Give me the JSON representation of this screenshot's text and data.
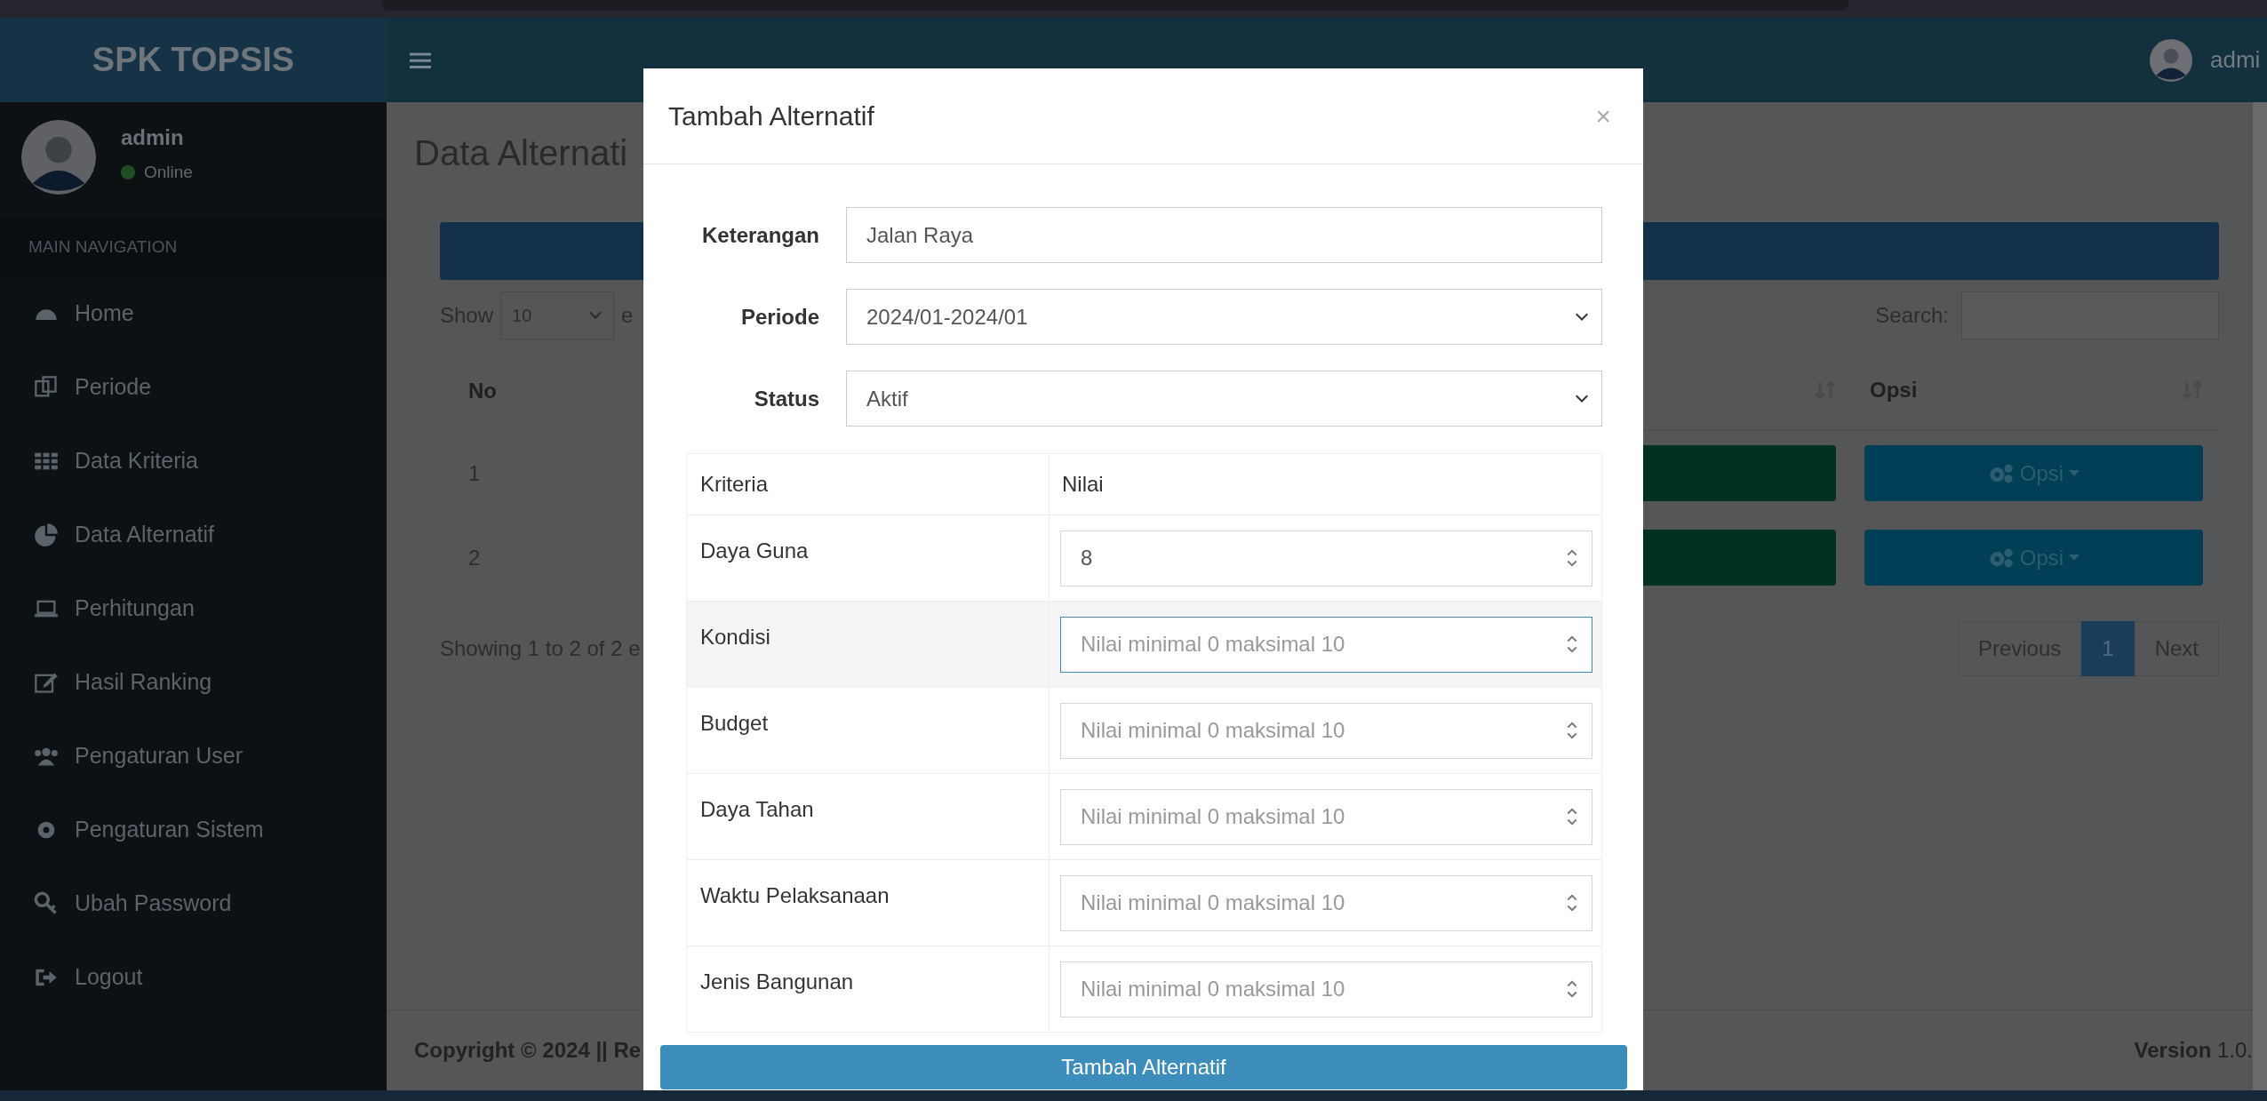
{
  "top_bar": {
    "brand": "SPK TOPSIS",
    "user_name": "admi"
  },
  "sidebar": {
    "user": {
      "name": "admin",
      "status": "Online"
    },
    "section_label": "MAIN NAVIGATION",
    "items": [
      {
        "label": "Home"
      },
      {
        "label": "Periode"
      },
      {
        "label": "Data Kriteria"
      },
      {
        "label": "Data Alternatif"
      },
      {
        "label": "Perhitungan"
      },
      {
        "label": "Hasil Ranking"
      },
      {
        "label": "Pengaturan User"
      },
      {
        "label": "Pengaturan Sistem"
      },
      {
        "label": "Ubah Password"
      },
      {
        "label": "Logout"
      }
    ]
  },
  "page": {
    "title": "Data Alternati",
    "show_label": "Show",
    "page_size": "10",
    "entries_fragment": "e",
    "search_label": "Search:",
    "table": {
      "columns": [
        "No",
        "Opsi"
      ],
      "rows": [
        {
          "no": "1",
          "action": "Opsi"
        },
        {
          "no": "2",
          "action": "Opsi"
        }
      ]
    },
    "info": "Showing 1 to 2 of 2 e",
    "pagination": [
      {
        "label": "Previous",
        "selected": false
      },
      {
        "label": "1",
        "selected": true
      },
      {
        "label": "Next",
        "selected": false
      }
    ]
  },
  "footer": {
    "copyright": "Copyright © 2024 || Re",
    "version": "**Version** 1.0."
  },
  "modal": {
    "title": "Tambah Alternatif",
    "close": "×",
    "fields": [
      {
        "label": "Keterangan",
        "kind": "text",
        "value": "Jalan Raya"
      },
      {
        "label": "Periode",
        "kind": "select",
        "value": "2024/01-2024/01"
      },
      {
        "label": "Status",
        "kind": "select",
        "value": "Aktif"
      }
    ],
    "criteria_table": {
      "columns": [
        "Kriteria",
        "Nilai"
      ],
      "rows": [
        {
          "name": "Daya Guna",
          "value": "8",
          "focused": false
        },
        {
          "name": "Kondisi",
          "placeholder": "Nilai minimal 0 maksimal 10",
          "focused": true
        },
        {
          "name": "Budget",
          "placeholder": "Nilai minimal 0 maksimal 10",
          "focused": false
        },
        {
          "name": "Daya Tahan",
          "placeholder": "Nilai minimal 0 maksimal 10",
          "focused": false
        },
        {
          "name": "Waktu Pelaksanaan",
          "placeholder": "Nilai minimal 0 maksimal 10",
          "focused": false
        },
        {
          "name": "Jenis Bangunan",
          "placeholder": "Nilai minimal 0 maksimal 10",
          "focused": false
        }
      ]
    },
    "submit": "Tambah Alternatif"
  }
}
